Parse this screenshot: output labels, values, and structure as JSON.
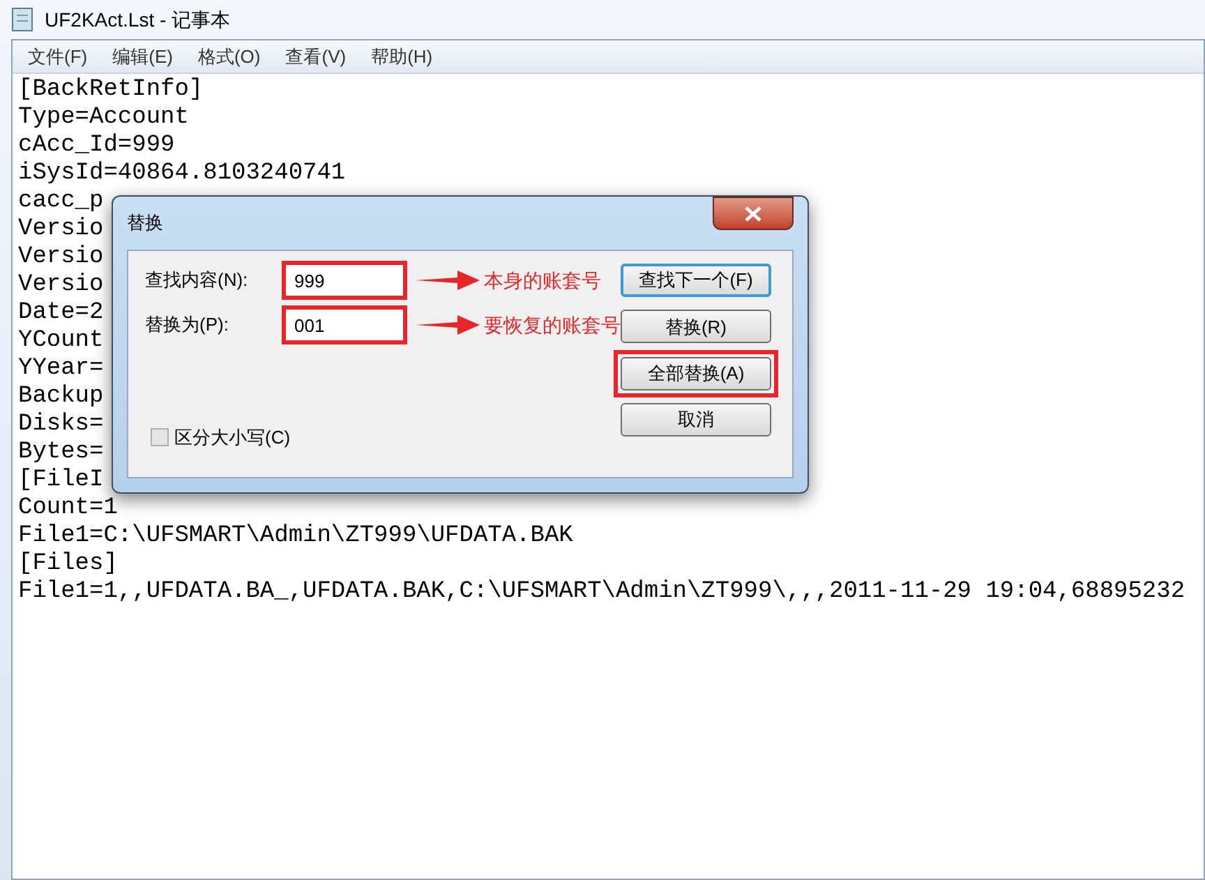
{
  "window": {
    "title": "UF2KAct.Lst - 记事本"
  },
  "menu": [
    "文件(F)",
    "编辑(E)",
    "格式(O)",
    "查看(V)",
    "帮助(H)"
  ],
  "editor": {
    "lines": [
      "[BackRetInfo]",
      "Type=Account",
      "cAcc_Id=999",
      "iSysId=40864.8103240741",
      "cacc_p",
      "Versio",
      "Versio",
      "Versio",
      "Date=2",
      "YCount",
      "YYear=",
      "Backup",
      "Disks=",
      "Bytes=",
      "[FileI",
      "Count=1",
      "File1=C:\\UFSMART\\Admin\\ZT999\\UFDATA.BAK",
      "[Files]",
      "File1=1,,UFDATA.BA_,UFDATA.BAK,C:\\UFSMART\\Admin\\ZT999\\,,,2011-11-29 19:04,68895232"
    ]
  },
  "dialog": {
    "title": "替换",
    "fields": [
      {
        "label": "查找内容(N):",
        "value": "999",
        "annotated": true,
        "note": "本身的账套号"
      },
      {
        "label": "替换为(P):",
        "value": "001",
        "annotated": true,
        "note": "要恢复的账套号"
      }
    ],
    "buttons": [
      {
        "label": "查找下一个(F)",
        "focused": true,
        "annotated": false
      },
      {
        "label": "替换(R)",
        "focused": false,
        "annotated": false
      },
      {
        "label": "全部替换(A)",
        "focused": false,
        "annotated": true
      },
      {
        "label": "取消",
        "focused": false,
        "annotated": false
      }
    ],
    "checkbox": {
      "label": "区分大小写(C)",
      "checked": false
    }
  }
}
